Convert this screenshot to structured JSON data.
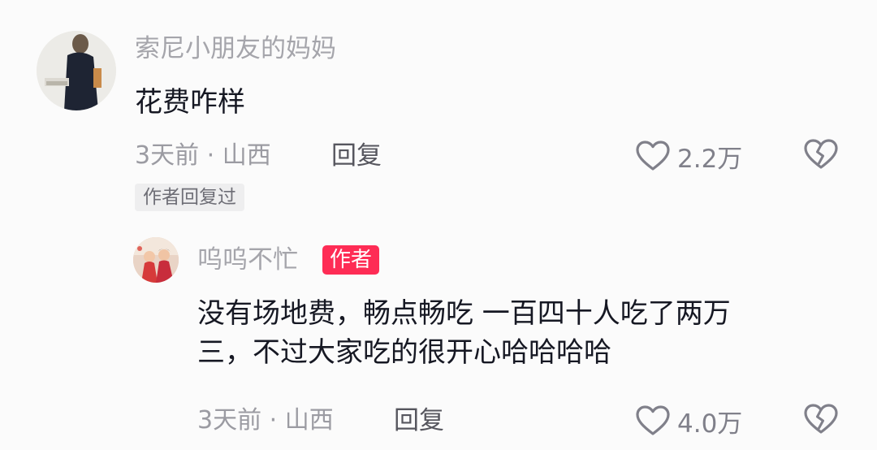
{
  "comment": {
    "username": "索尼小朋友的妈妈",
    "text": "花费咋样",
    "time_location": "3天前 · 山西",
    "reply_label": "回复",
    "like_count": "2.2万",
    "author_replied_tag": "作者回复过"
  },
  "reply": {
    "username": "呜呜不忙",
    "author_badge": "作者",
    "text_lines": [
      "没有场地费，畅点畅吃 一百四十人吃了两万",
      "三，不过大家吃的很开心哈哈哈哈"
    ],
    "time_location": "3天前 · 山西",
    "reply_label": "回复",
    "like_count": "4.0万"
  },
  "icons": {
    "like": "heart-outline-icon",
    "dislike": "broken-heart-icon"
  },
  "colors": {
    "background": "#fbfbfb",
    "primary_text": "#161823",
    "secondary_text": "#a5a5ab",
    "author_badge": "#fe2c55"
  }
}
